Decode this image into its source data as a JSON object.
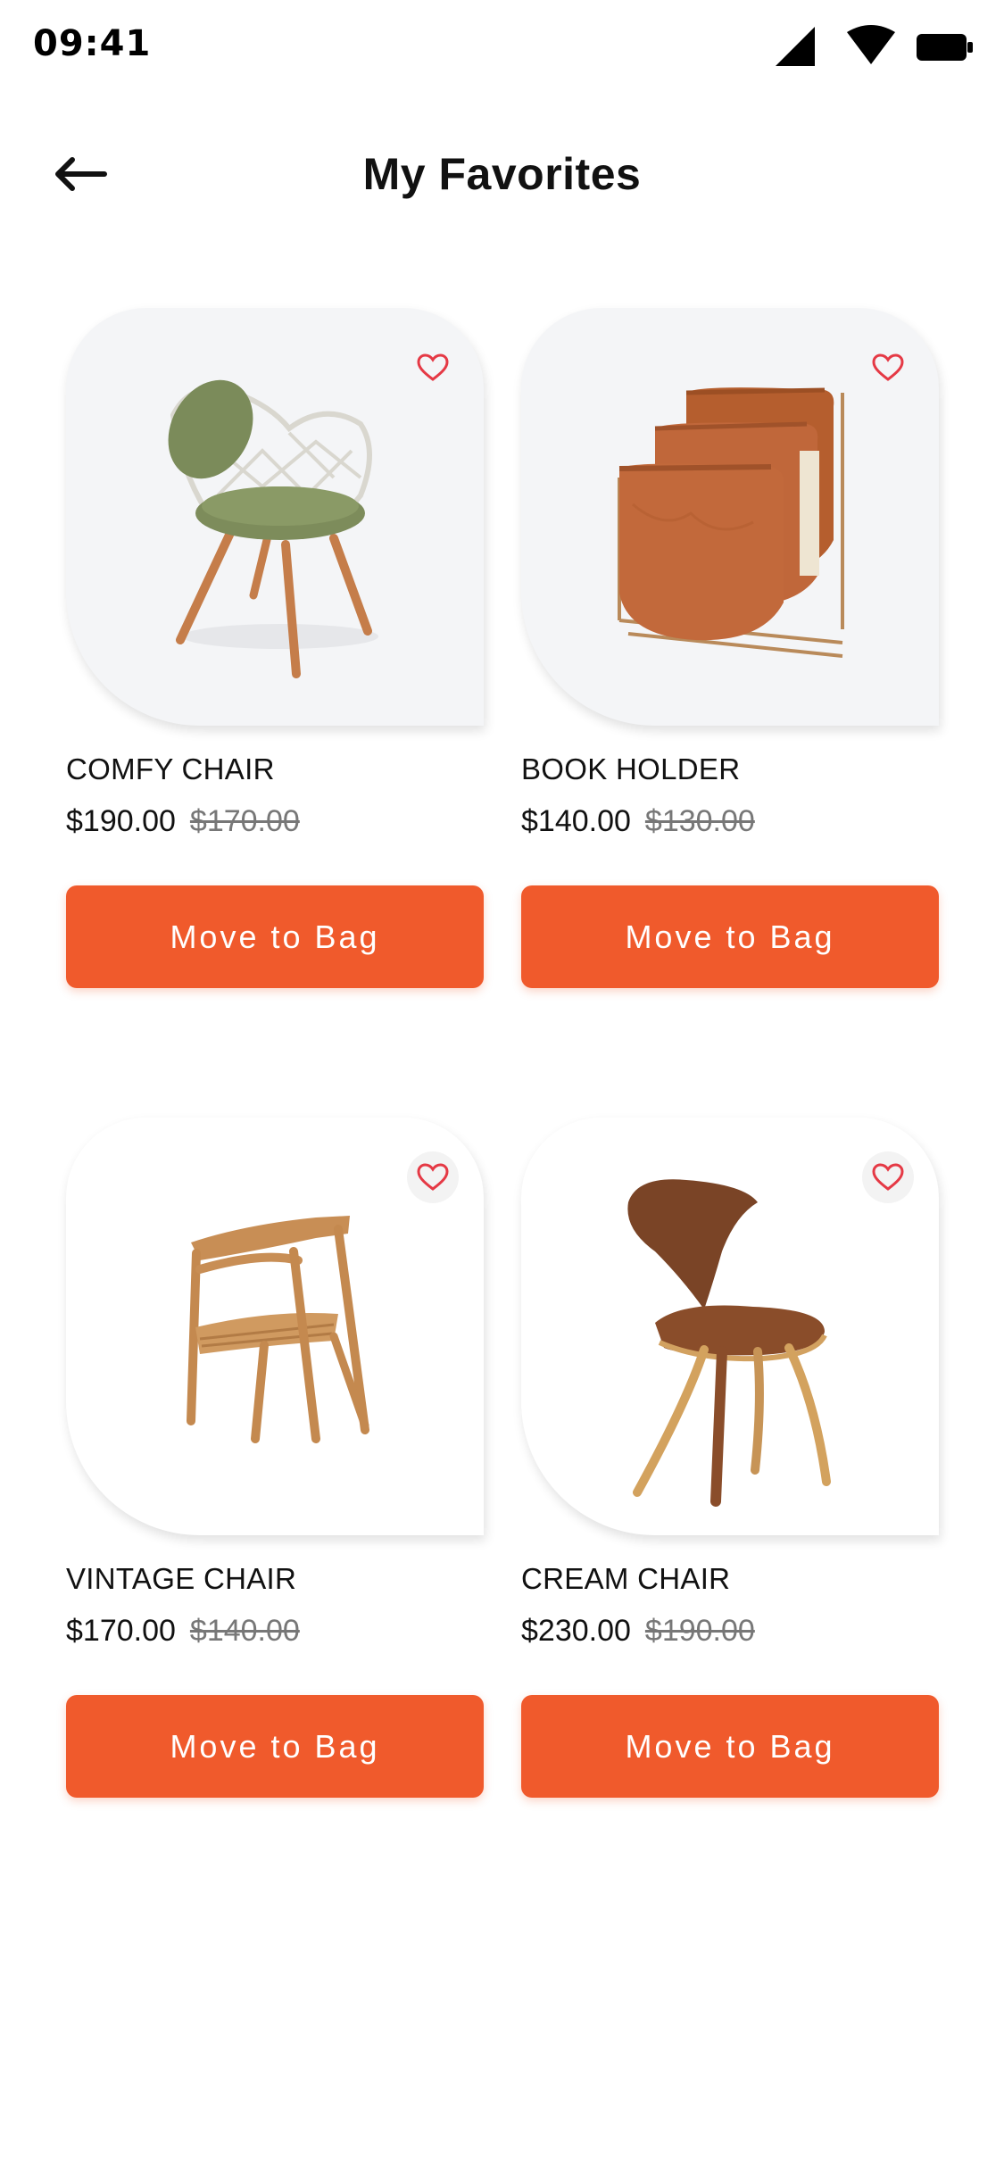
{
  "status_bar": {
    "time": "09:41",
    "icons": [
      "signal-icon",
      "wifi-icon",
      "battery-icon"
    ]
  },
  "header": {
    "title": "My Favorites",
    "back_icon": "arrow-left-icon"
  },
  "colors": {
    "accent": "#f05a2c",
    "heart": "#e53945",
    "card_bg_grey": "#f4f5f7"
  },
  "products": [
    {
      "name": "COMFY CHAIR",
      "price": "$190.00",
      "old_price": "$170.00",
      "button": "Move to Bag",
      "favorite": true
    },
    {
      "name": "BOOK HOLDER",
      "price": "$140.00",
      "old_price": "$130.00",
      "button": "Move to Bag",
      "favorite": true
    },
    {
      "name": "VINTAGE CHAIR",
      "price": "$170.00",
      "old_price": "$140.00",
      "button": "Move to Bag",
      "favorite": true
    },
    {
      "name": "CREAM CHAIR",
      "price": "$230.00",
      "old_price": "$190.00",
      "button": "Move to Bag",
      "favorite": true
    }
  ]
}
